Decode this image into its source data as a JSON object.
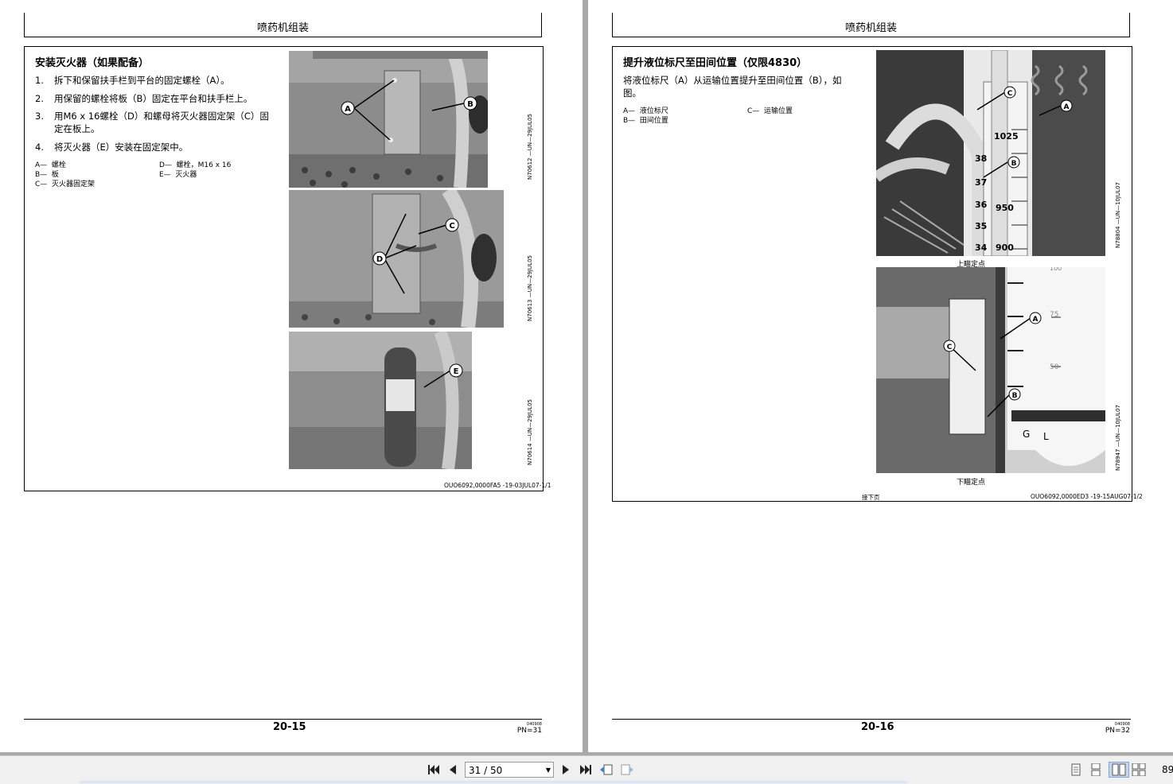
{
  "left_page": {
    "header": "喷药机组装",
    "title": "安装灭火器（如果配备）",
    "steps": [
      {
        "num": "1.",
        "text": "拆下和保留扶手栏到平台的固定螺栓（A）。"
      },
      {
        "num": "2.",
        "text": "用保留的螺栓将板（B）固定在平台和扶手栏上。"
      },
      {
        "num": "3.",
        "text": "用M6 x 16螺栓（D）和螺母将灭火器固定架（C）固",
        "text2": "定在板上。"
      },
      {
        "num": "4.",
        "text": "将灭火器（E）安装在固定架中。"
      }
    ],
    "legend": [
      {
        "key": "A—",
        "val": "螺栓"
      },
      {
        "key": "B—",
        "val": "板"
      },
      {
        "key": "C—",
        "val": "灭火器固定架"
      },
      {
        "key": "D—",
        "val": "螺栓，M16 x 16"
      },
      {
        "key": "E—",
        "val": "灭火器"
      }
    ],
    "photo_codes": [
      "N70612 —UN—29JUL05",
      "N70613 —UN—29JUL05",
      "N70614 —UN—29JUL05"
    ],
    "callouts": {
      "a": "A",
      "b": "B",
      "c": "C",
      "d": "D",
      "e": "E"
    },
    "doc_code": "OUO6092,0000FA5 -19-03JUL07-1/1",
    "page_number": "20-15",
    "small_code": "040908",
    "pn": "PN=31"
  },
  "right_page": {
    "header": "喷药机组装",
    "title": "提升液位标尺至田间位置（仅限4830）",
    "body_line1": "将液位标尺（A）从运输位置提升至田间位置（B），如",
    "body_line2": "图。",
    "legend": [
      {
        "key": "A—",
        "val": "液位标尺"
      },
      {
        "key": "B—",
        "val": "田间位置"
      },
      {
        "key": "C—",
        "val": "运输位置"
      }
    ],
    "photo_codes": [
      "N78804 —UN—10JUL07",
      "N78947 —UN—10JUL07"
    ],
    "gauge_numbers": [
      "1025",
      "950",
      "900",
      "38",
      "37",
      "36",
      "35",
      "34"
    ],
    "tank_numbers": [
      "75",
      "50",
      "100",
      "G",
      "L"
    ],
    "caption_top": "上瞄定点",
    "caption_bottom": "下瞄定点",
    "continued": "接下页",
    "doc_code": "OUO6092,0000ED3 -19-15AUG07-1/2",
    "page_number": "20-16",
    "small_code": "040908",
    "pn": "PN=32"
  },
  "toolbar": {
    "page_field": "31 / 50",
    "zoom": "89"
  }
}
